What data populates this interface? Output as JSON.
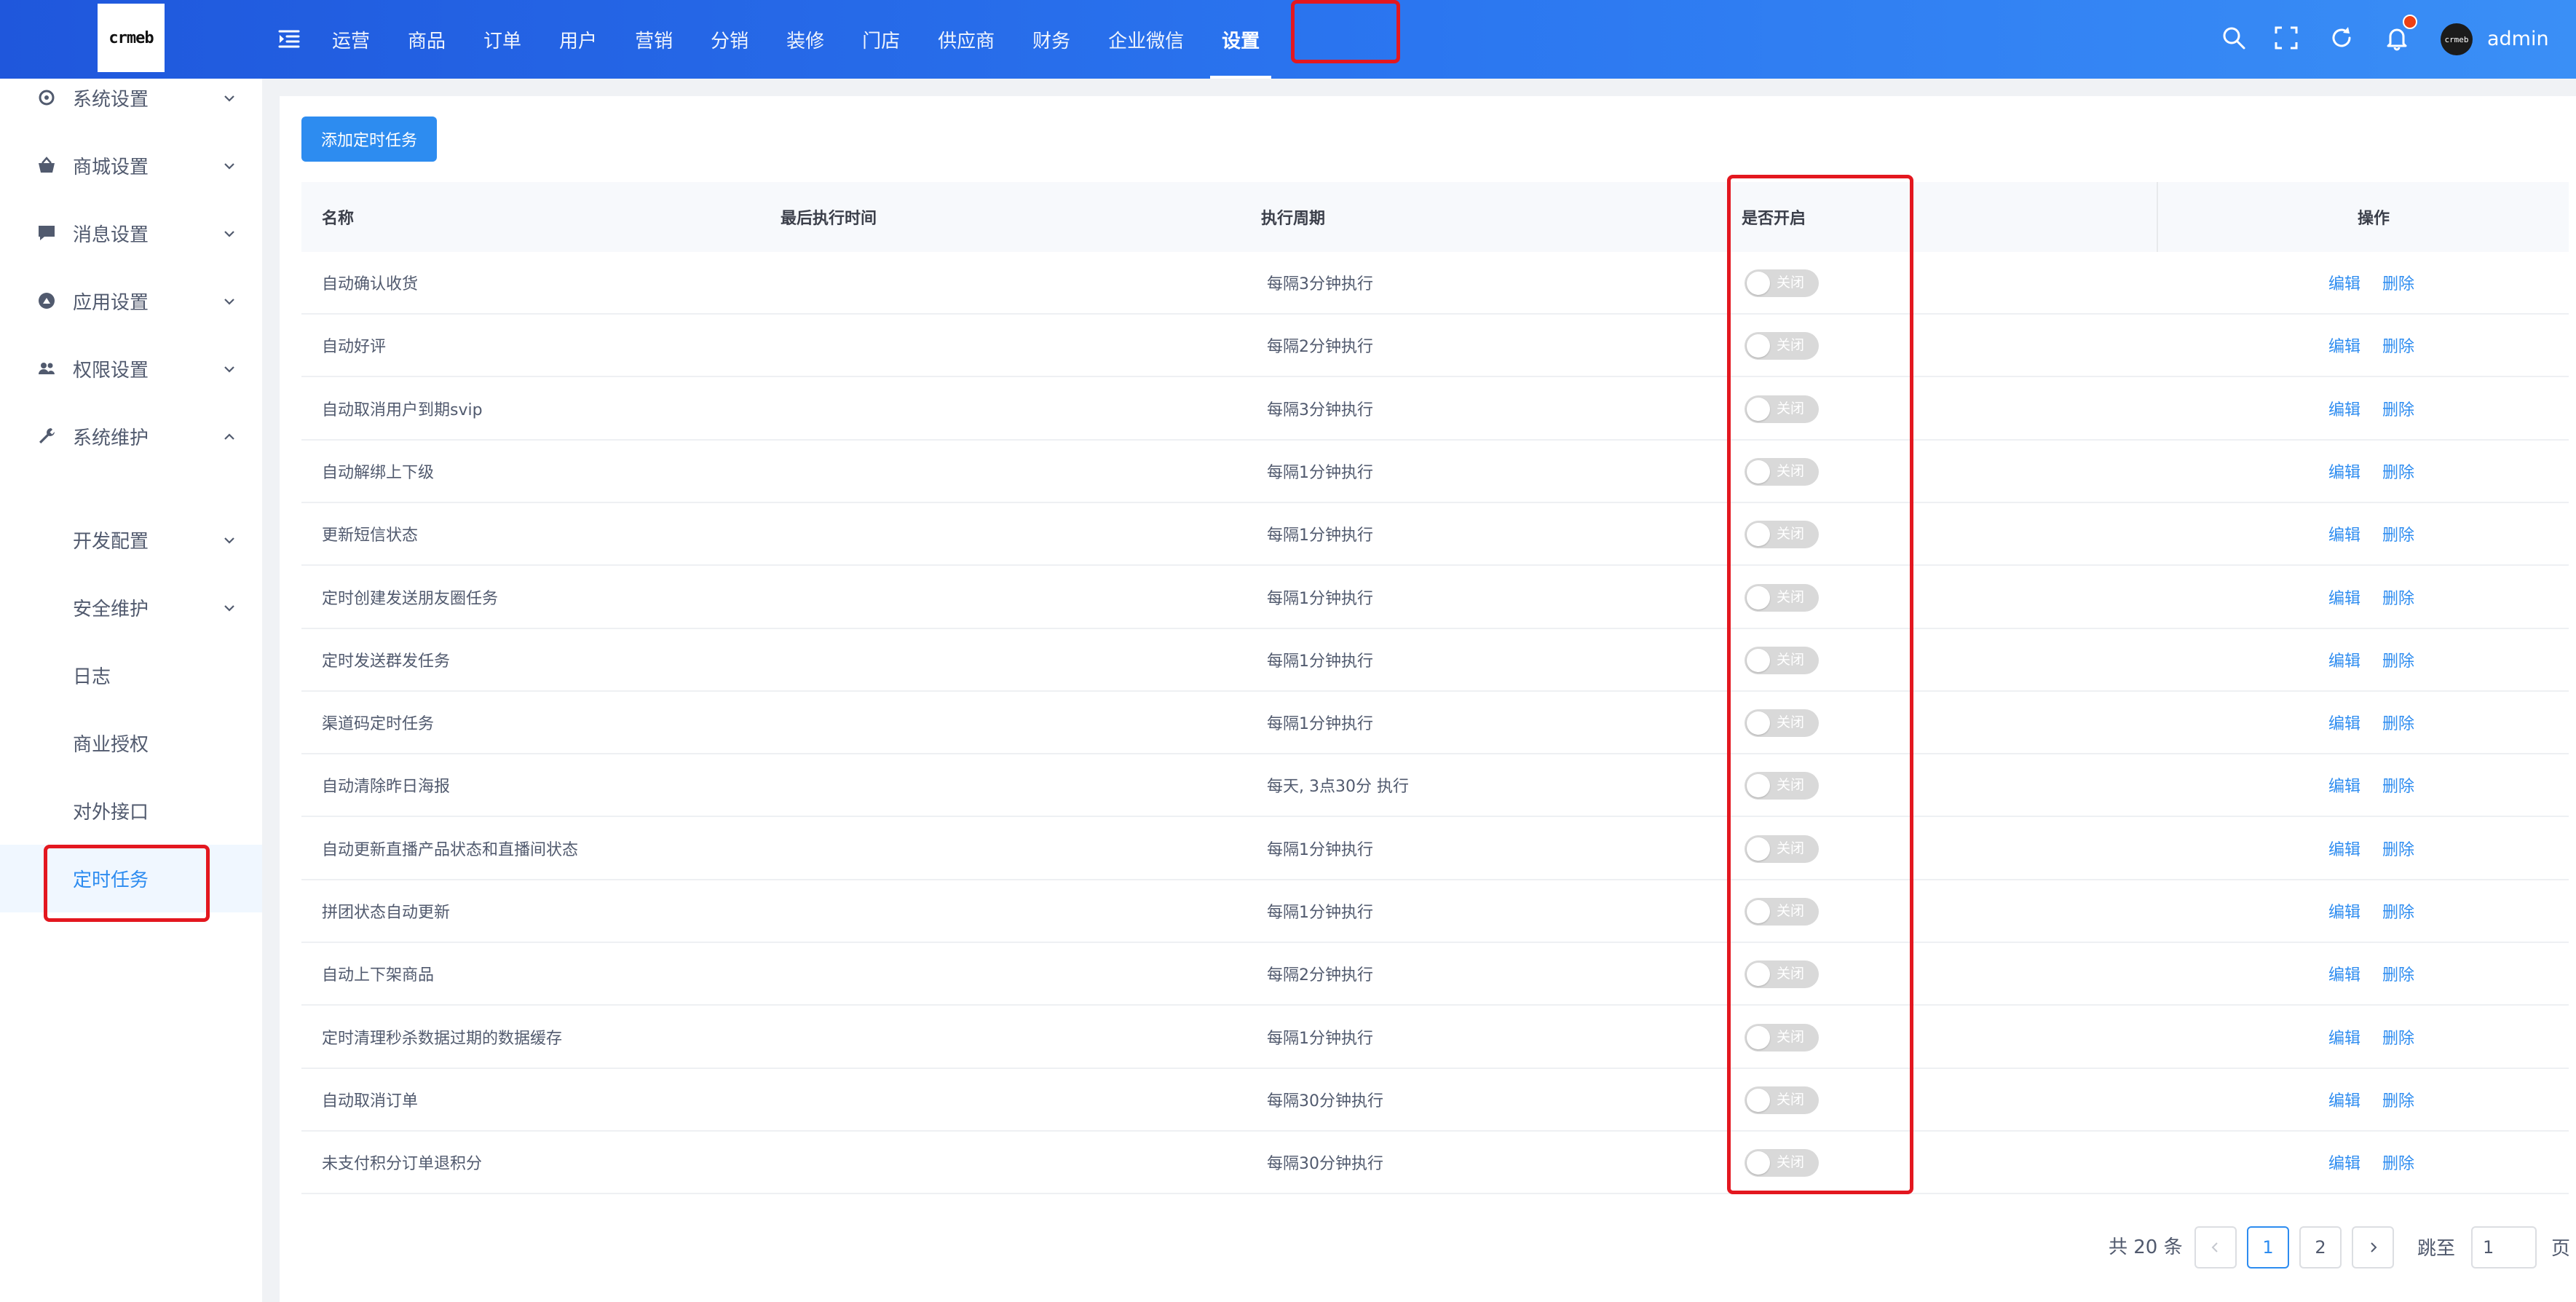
{
  "header": {
    "logo_text": "crmeb",
    "nav": [
      "运营",
      "商品",
      "订单",
      "用户",
      "营销",
      "分销",
      "装修",
      "门店",
      "供应商",
      "财务",
      "企业微信",
      "设置"
    ],
    "active_nav": "设置",
    "username": "admin",
    "avatar_text": "crmeb"
  },
  "sidebar": {
    "items": [
      {
        "label": "系统设置",
        "icon": "gear-icon",
        "expanded": false
      },
      {
        "label": "商城设置",
        "icon": "basket-icon",
        "expanded": false
      },
      {
        "label": "消息设置",
        "icon": "message-icon",
        "expanded": false
      },
      {
        "label": "应用设置",
        "icon": "app-icon",
        "expanded": false
      },
      {
        "label": "权限设置",
        "icon": "users-icon",
        "expanded": false
      },
      {
        "label": "系统维护",
        "icon": "wrench-icon",
        "expanded": true
      }
    ],
    "subitems": [
      {
        "label": "开发配置",
        "has_chevron": true
      },
      {
        "label": "安全维护",
        "has_chevron": true
      },
      {
        "label": "日志",
        "has_chevron": false
      },
      {
        "label": "商业授权",
        "has_chevron": false
      },
      {
        "label": "对外接口",
        "has_chevron": false
      },
      {
        "label": "定时任务",
        "has_chevron": false,
        "active": true
      }
    ]
  },
  "toolbar": {
    "add_button": "添加定时任务"
  },
  "table": {
    "headers": {
      "name": "名称",
      "last_run": "最后执行时间",
      "period": "执行周期",
      "enabled": "是否开启",
      "ops": "操作"
    },
    "rows": [
      {
        "name": "自动确认收货",
        "last_run": "",
        "period": "每隔3分钟执行",
        "status": "关闭"
      },
      {
        "name": "自动好评",
        "last_run": "",
        "period": "每隔2分钟执行",
        "status": "关闭"
      },
      {
        "name": "自动取消用户到期svip",
        "last_run": "",
        "period": "每隔3分钟执行",
        "status": "关闭"
      },
      {
        "name": "自动解绑上下级",
        "last_run": "",
        "period": "每隔1分钟执行",
        "status": "关闭"
      },
      {
        "name": "更新短信状态",
        "last_run": "",
        "period": "每隔1分钟执行",
        "status": "关闭"
      },
      {
        "name": "定时创建发送朋友圈任务",
        "last_run": "",
        "period": "每隔1分钟执行",
        "status": "关闭"
      },
      {
        "name": "定时发送群发任务",
        "last_run": "",
        "period": "每隔1分钟执行",
        "status": "关闭"
      },
      {
        "name": "渠道码定时任务",
        "last_run": "",
        "period": "每隔1分钟执行",
        "status": "关闭"
      },
      {
        "name": "自动清除昨日海报",
        "last_run": "",
        "period": "每天, 3点30分 执行",
        "status": "关闭"
      },
      {
        "name": "自动更新直播产品状态和直播间状态",
        "last_run": "",
        "period": "每隔1分钟执行",
        "status": "关闭"
      },
      {
        "name": "拼团状态自动更新",
        "last_run": "",
        "period": "每隔1分钟执行",
        "status": "关闭"
      },
      {
        "name": "自动上下架商品",
        "last_run": "",
        "period": "每隔2分钟执行",
        "status": "关闭"
      },
      {
        "name": "定时清理秒杀数据过期的数据缓存",
        "last_run": "",
        "period": "每隔1分钟执行",
        "status": "关闭"
      },
      {
        "name": "自动取消订单",
        "last_run": "",
        "period": "每隔30分钟执行",
        "status": "关闭"
      },
      {
        "name": "未支付积分订单退积分",
        "last_run": "",
        "period": "每隔30分钟执行",
        "status": "关闭"
      }
    ],
    "edit_label": "编辑",
    "delete_label": "删除"
  },
  "pagination": {
    "total_text": "共 20 条",
    "pages": [
      "1",
      "2"
    ],
    "current_page": "1",
    "jump_label": "跳至",
    "jump_value": "1",
    "jump_suffix": "页"
  },
  "colors": {
    "primary": "#2d8cf0",
    "highlight": "#e3171f",
    "header_start": "#1f57dc",
    "header_end": "#3a8ff6"
  }
}
